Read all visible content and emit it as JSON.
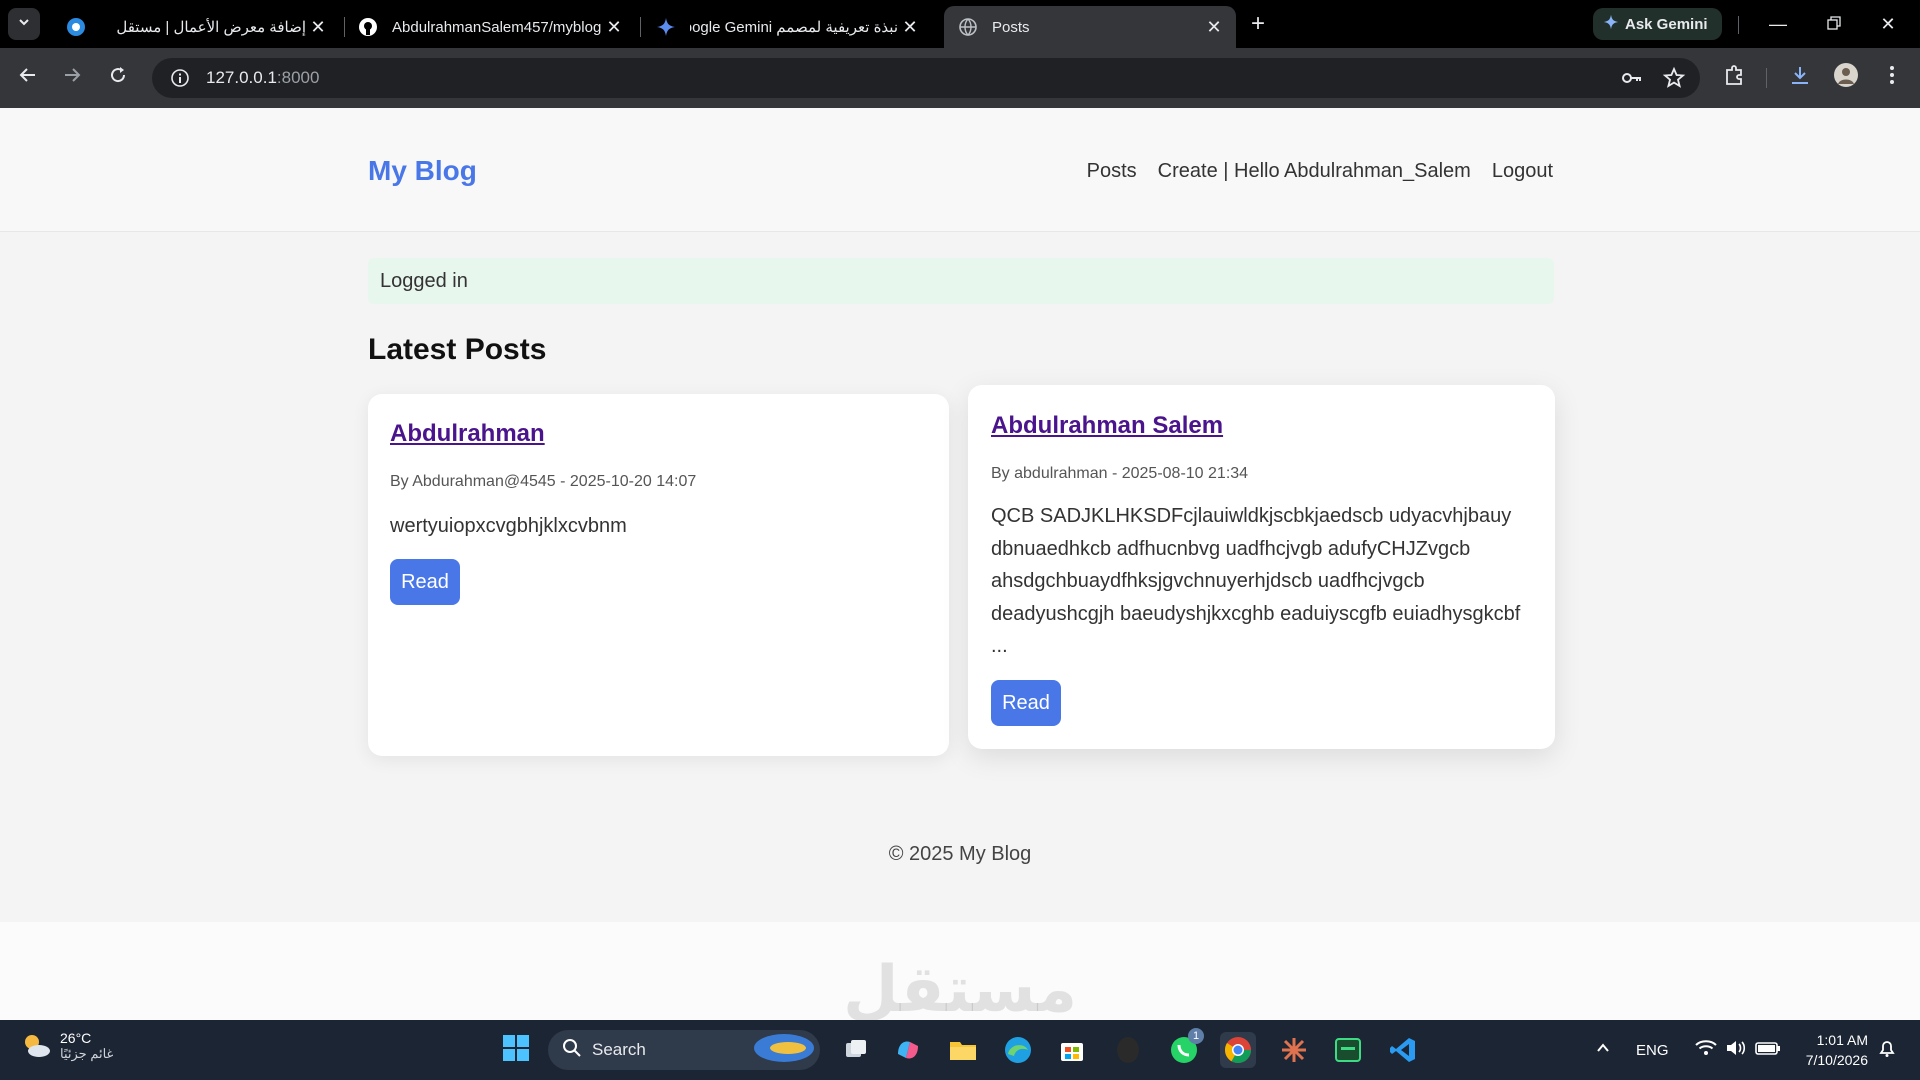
{
  "browser": {
    "tabs": [
      {
        "title": "إضافة معرض الأعمال | مستقل",
        "icon": "mostaql-icon"
      },
      {
        "title": "AbdulrahmanSalem457/myblog",
        "icon": "github-icon"
      },
      {
        "title": "نبذة تعريفية لمصمم Google Gemini",
        "icon": "gemini-icon"
      },
      {
        "title": "Posts",
        "icon": "globe-icon",
        "active": true
      }
    ],
    "ask_gemini_label": "Ask Gemini",
    "url_host": "127.0.0.1",
    "url_port": ":8000"
  },
  "site": {
    "brand": "My Blog",
    "nav": {
      "posts": "Posts",
      "create": "Create",
      "separator": " | ",
      "greeting": "Hello Abdulrahman_Salem",
      "logout": "Logout"
    },
    "alert": "Logged in",
    "section_title": "Latest Posts",
    "posts": [
      {
        "title": "Abdulrahman",
        "meta": "By Abdurahman@4545 - 2025-10-20 14:07",
        "body_lines": [
          "wertyuiopxcvgbhjklxcvbnm"
        ],
        "read_label": "Read"
      },
      {
        "title": "Abdulrahman Salem",
        "meta": "By abdulrahman - 2025-08-10 21:34",
        "body_lines": [
          "QCB SADJKLHKSDFcjlauiwldkjscbkjaedscb udyacvhjbauy",
          "dbnuaedhkcb adfhucnbvg uadfhcjvgb adufyCHJZvgcb",
          "ahsdgchbuaydfhksjgvchnuyerhjdscb uadfhcjvgcb",
          "deadyushcgjh baeudyshjkxcghb eaduiyscgfb euiadhysgkcbf",
          "..."
        ],
        "read_label": "Read"
      }
    ],
    "footer": "© 2025 My Blog",
    "watermark": "مستقل"
  },
  "taskbar": {
    "weather_temp": "26°C",
    "weather_cond": "غائم جزئيًا",
    "search_label": "Search",
    "lang": "ENG",
    "time": "1:01 AM",
    "date": "7/10/2026",
    "whatsapp_badge": "1"
  },
  "colors": {
    "brand": "#4a77e8",
    "link_visited": "#4a148c",
    "alert_bg": "#e8f7ee"
  }
}
